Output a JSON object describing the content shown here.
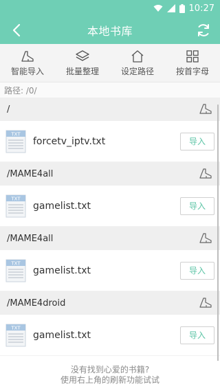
{
  "status_bar": {
    "time": "10:27"
  },
  "app_bar": {
    "title": "本地书库"
  },
  "toolbar": {
    "smart_import": "智能导入",
    "batch_organize": "批量整理",
    "set_path": "设定路径",
    "by_initial": "按首字母"
  },
  "path_label": "路径: /0/",
  "sections": [
    {
      "dir": "/",
      "file": "forcetv_iptv.txt",
      "import_label": "导入",
      "icon_label": "TXT"
    },
    {
      "dir": "/MAME4all",
      "file": "gamelist.txt",
      "import_label": "导入",
      "icon_label": "TXT"
    },
    {
      "dir": "/MAME4all",
      "file": "gamelist.txt",
      "import_label": "导入",
      "icon_label": "TXT"
    },
    {
      "dir": "/MAME4droid",
      "file": "gamelist.txt",
      "import_label": "导入",
      "icon_label": "TXT"
    }
  ],
  "hint": {
    "line1": "没有找到心爱的书籍?",
    "line2": "使用右上角的刷新功能试试"
  },
  "colors": {
    "accent": "#6fcfb5",
    "button_text": "#5fc5a7"
  }
}
